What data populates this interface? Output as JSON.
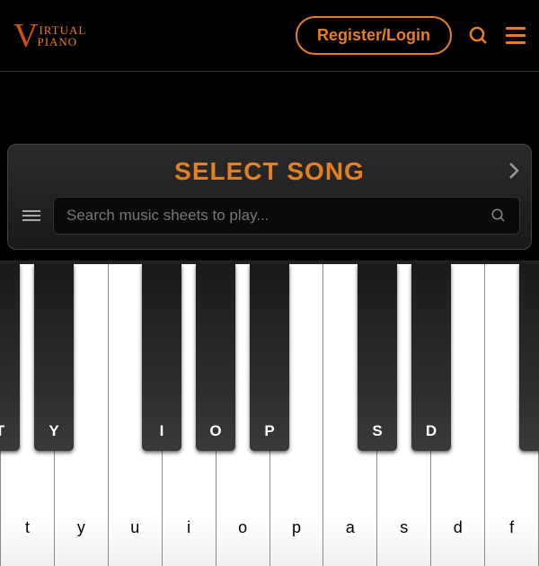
{
  "header": {
    "logo_line1": "IRTUAL",
    "logo_line2": "IANO",
    "register_label": "Register/Login"
  },
  "song_panel": {
    "title": "SELECT SONG",
    "search_placeholder": "Search music sheets to play..."
  },
  "piano": {
    "white_keys": [
      "t",
      "y",
      "u",
      "i",
      "o",
      "p",
      "a",
      "s",
      "d",
      "f"
    ],
    "black_keys": [
      {
        "label": "T",
        "pos": -22
      },
      {
        "label": "Y",
        "pos": 38
      },
      {
        "label": "I",
        "pos": 158
      },
      {
        "label": "O",
        "pos": 218
      },
      {
        "label": "P",
        "pos": 278
      },
      {
        "label": "S",
        "pos": 398
      },
      {
        "label": "D",
        "pos": 458
      },
      {
        "label": "",
        "pos": 578
      }
    ]
  }
}
